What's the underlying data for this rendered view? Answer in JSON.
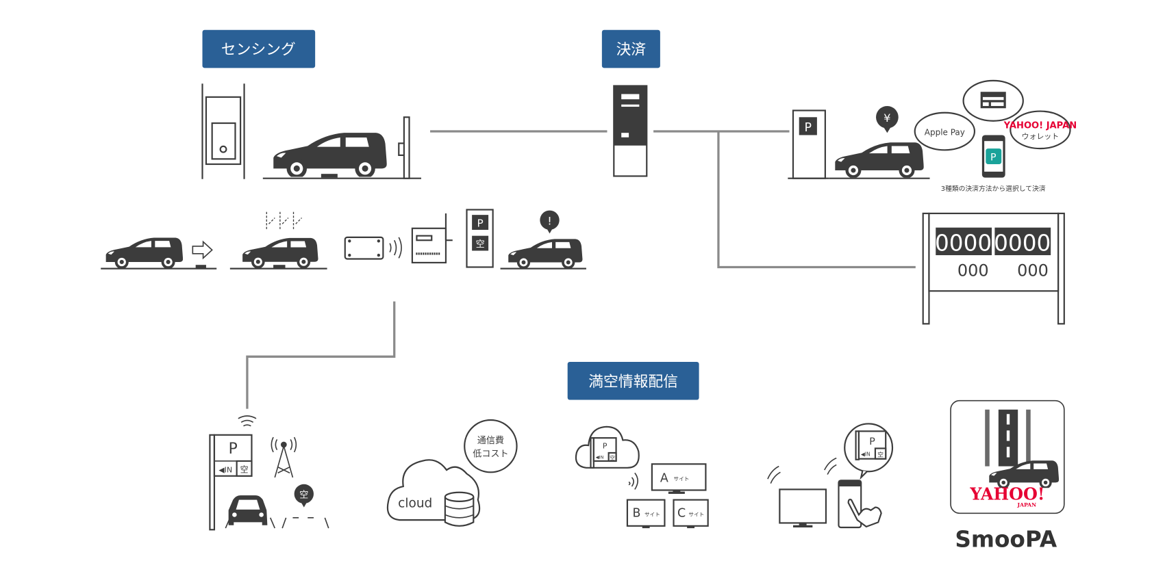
{
  "sections": {
    "sensing": "センシング",
    "payment": "決済",
    "availability": "満空情報配信"
  },
  "colors": {
    "header": "#2a6096",
    "dark": "#3c3c3c",
    "line": "#8a8a8a",
    "teal": "#1aa39a",
    "yahoo_red": "#e60033"
  },
  "payment": {
    "parking_sign": "P",
    "yen": "¥",
    "apple_pay": "Apple Pay",
    "yahoo_logo": "YAHOO! JAPAN",
    "yahoo_wallet": "ウォレット",
    "caption": "3種類の決済方法から選択して決済"
  },
  "display_board": {
    "big_left": "0000",
    "big_right": "0000",
    "small_left": "000",
    "small_right": "000"
  },
  "sensing_row": {
    "parking_sign": "P",
    "vacant": "空",
    "alert": "!"
  },
  "signage": {
    "parking": "P",
    "in": "◀IN",
    "vacant": "空"
  },
  "cloud": {
    "label": "cloud",
    "bubble_line1": "通信費",
    "bubble_line2": "低コスト"
  },
  "sites": {
    "a_letter": "A",
    "b_letter": "B",
    "c_letter": "C",
    "suffix": "サイト"
  },
  "logo": {
    "yahoo": "YAHOO!",
    "japan": "JAPAN",
    "name": "SmooPA"
  }
}
